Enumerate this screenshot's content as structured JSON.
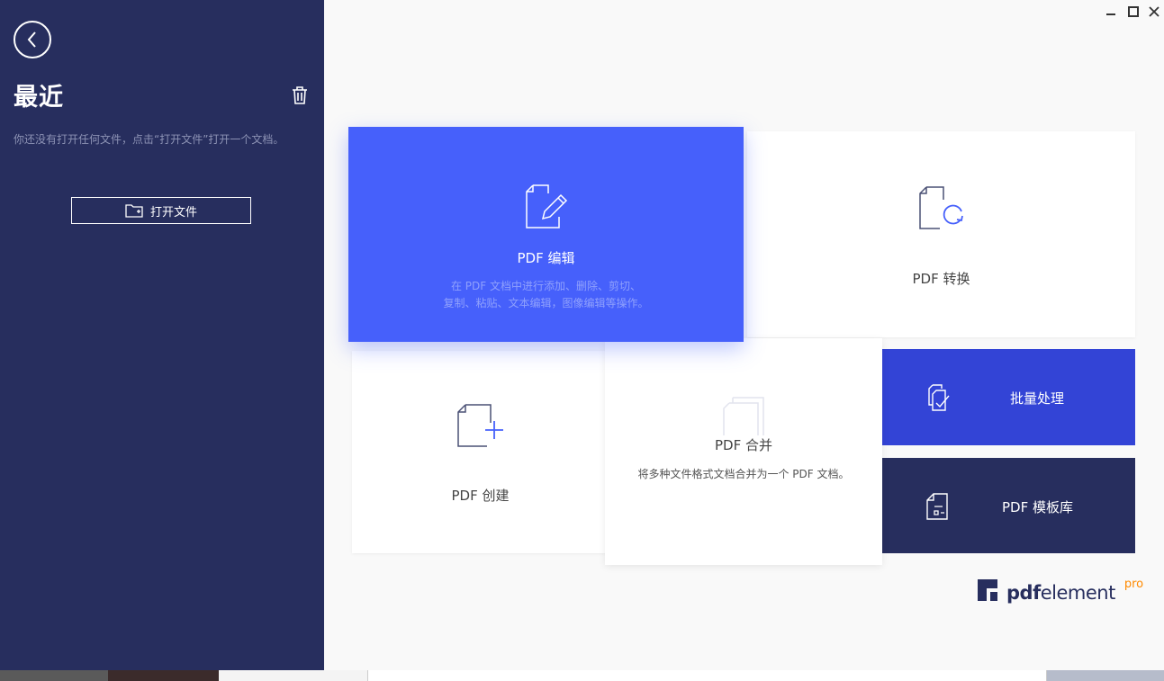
{
  "sidebar": {
    "title": "最近",
    "empty_message": "你还没有打开任何文件，点击“打开文件”打开一个文档。",
    "open_button_label": "打开文件"
  },
  "tiles": {
    "edit": {
      "title": "PDF 编辑",
      "description_line1": "在 PDF 文档中进行添加、删除、剪切、",
      "description_line2": "复制、粘贴、文本编辑，图像编辑等操作。"
    },
    "convert": {
      "title": "PDF 转换"
    },
    "create": {
      "title": "PDF 创建"
    },
    "merge": {
      "title": "PDF 合并",
      "description": "将多种文件格式文档合并为一个 PDF 文档。"
    },
    "batch": {
      "title": "批量处理"
    },
    "template": {
      "title": "PDF 模板库"
    }
  },
  "brand": {
    "name_bold": "pdf",
    "name_rest": "element",
    "edition": "pro"
  },
  "colors": {
    "sidebar": "#272e5e",
    "accent": "#4660fb",
    "batch": "#3344d6",
    "pro": "#ff8a00"
  }
}
